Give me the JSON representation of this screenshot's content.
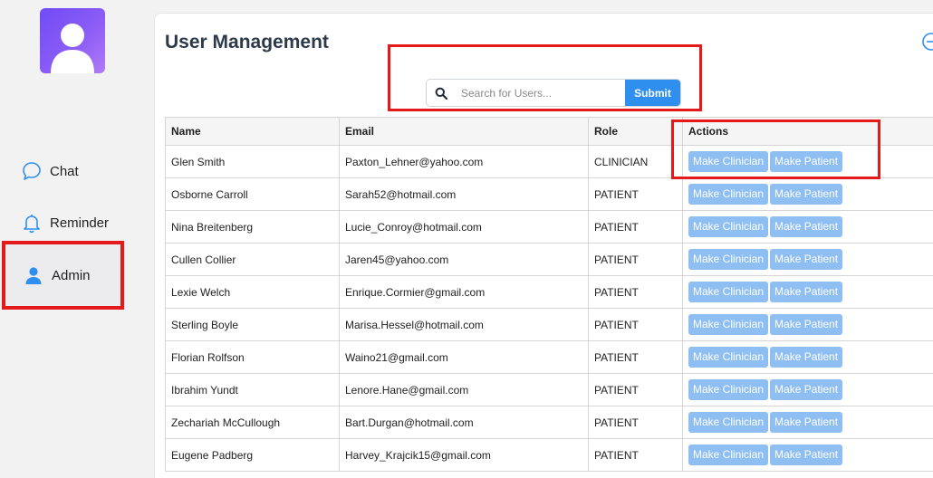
{
  "sidebar": {
    "items": [
      {
        "label": "Chat",
        "icon": "chat-bubble-icon"
      },
      {
        "label": "Reminder",
        "icon": "bell-icon"
      },
      {
        "label": "Admin",
        "icon": "user-icon"
      }
    ],
    "accent_color": "#2f8fef"
  },
  "main": {
    "title": "User Management",
    "search": {
      "placeholder": "Search for Users...",
      "value": "",
      "submit_label": "Submit"
    },
    "table": {
      "headers": [
        "Name",
        "Email",
        "Role",
        "Actions"
      ],
      "action_labels": {
        "clinician": "Make Clinician",
        "patient": "Make Patient"
      },
      "rows": [
        {
          "name": "Glen Smith",
          "email": "Paxton_Lehner@yahoo.com",
          "role": "CLINICIAN"
        },
        {
          "name": "Osborne Carroll",
          "email": "Sarah52@hotmail.com",
          "role": "PATIENT"
        },
        {
          "name": "Nina Breitenberg",
          "email": "Lucie_Conroy@hotmail.com",
          "role": "PATIENT"
        },
        {
          "name": "Cullen Collier",
          "email": "Jaren45@yahoo.com",
          "role": "PATIENT"
        },
        {
          "name": "Lexie Welch",
          "email": "Enrique.Cormier@gmail.com",
          "role": "PATIENT"
        },
        {
          "name": "Sterling Boyle",
          "email": "Marisa.Hessel@hotmail.com",
          "role": "PATIENT"
        },
        {
          "name": "Florian Rolfson",
          "email": "Waino21@gmail.com",
          "role": "PATIENT"
        },
        {
          "name": "Ibrahim Yundt",
          "email": "Lenore.Hane@gmail.com",
          "role": "PATIENT"
        },
        {
          "name": "Zechariah McCullough",
          "email": "Bart.Durgan@hotmail.com",
          "role": "PATIENT"
        },
        {
          "name": "Eugene Padberg",
          "email": "Harvey_Krajcik15@gmail.com",
          "role": "PATIENT"
        }
      ]
    },
    "highlight_color": "#e41a1a"
  }
}
